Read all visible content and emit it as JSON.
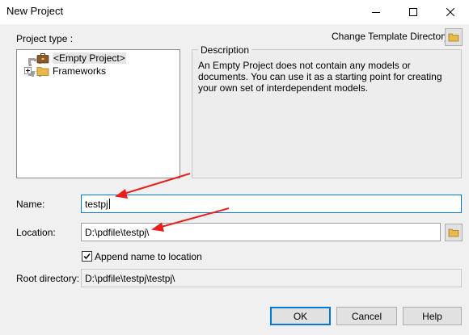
{
  "window": {
    "title": "New Project"
  },
  "project_type": {
    "label": "Project type :",
    "items": [
      {
        "label": "<Empty Project>",
        "icon": "briefcase-icon",
        "selected": true
      },
      {
        "label": "Frameworks",
        "icon": "folder-icon",
        "expandable": true
      }
    ]
  },
  "template": {
    "change_label": "Change Template Directory:"
  },
  "description": {
    "legend": "Description",
    "text": "An Empty Project does not contain any models or documents. You can use it as a starting point for creating your own set of interdependent models."
  },
  "name": {
    "label": "Name:",
    "value": "testpj"
  },
  "location": {
    "label": "Location:",
    "value": "D:\\pdfile\\testpj\\"
  },
  "append": {
    "label": "Append name to location",
    "checked": true
  },
  "root_directory": {
    "label": "Root directory:",
    "value": "D:\\pdfile\\testpj\\testpj\\"
  },
  "buttons": {
    "ok": "OK",
    "cancel": "Cancel",
    "help": "Help"
  },
  "colors": {
    "accent": "#0078d7",
    "annotation_arrow": "#e8201c",
    "folder": "#e8b84a"
  }
}
